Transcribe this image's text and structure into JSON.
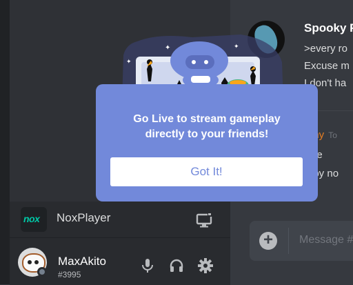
{
  "chat": {
    "author": "Spooky F",
    "lines": [
      ">every ro",
      "Excuse m",
      "I don't ha"
    ],
    "second_author": "nny",
    "second_time": "To",
    "second_lines": [
      "ere",
      "ppy no"
    ],
    "composer_placeholder": "Message #"
  },
  "game": {
    "logo_text": "nox",
    "name": "NoxPlayer"
  },
  "user": {
    "name": "MaxAkito",
    "discriminator": "#3995"
  },
  "popup": {
    "line1": "Go Live to stream gameplay",
    "line2": "directly to your friends!",
    "button": "Got It!"
  },
  "colors": {
    "blurple": "#7289da",
    "background": "#36393f",
    "sidebar": "#2f3136",
    "panel": "#292b2f"
  }
}
